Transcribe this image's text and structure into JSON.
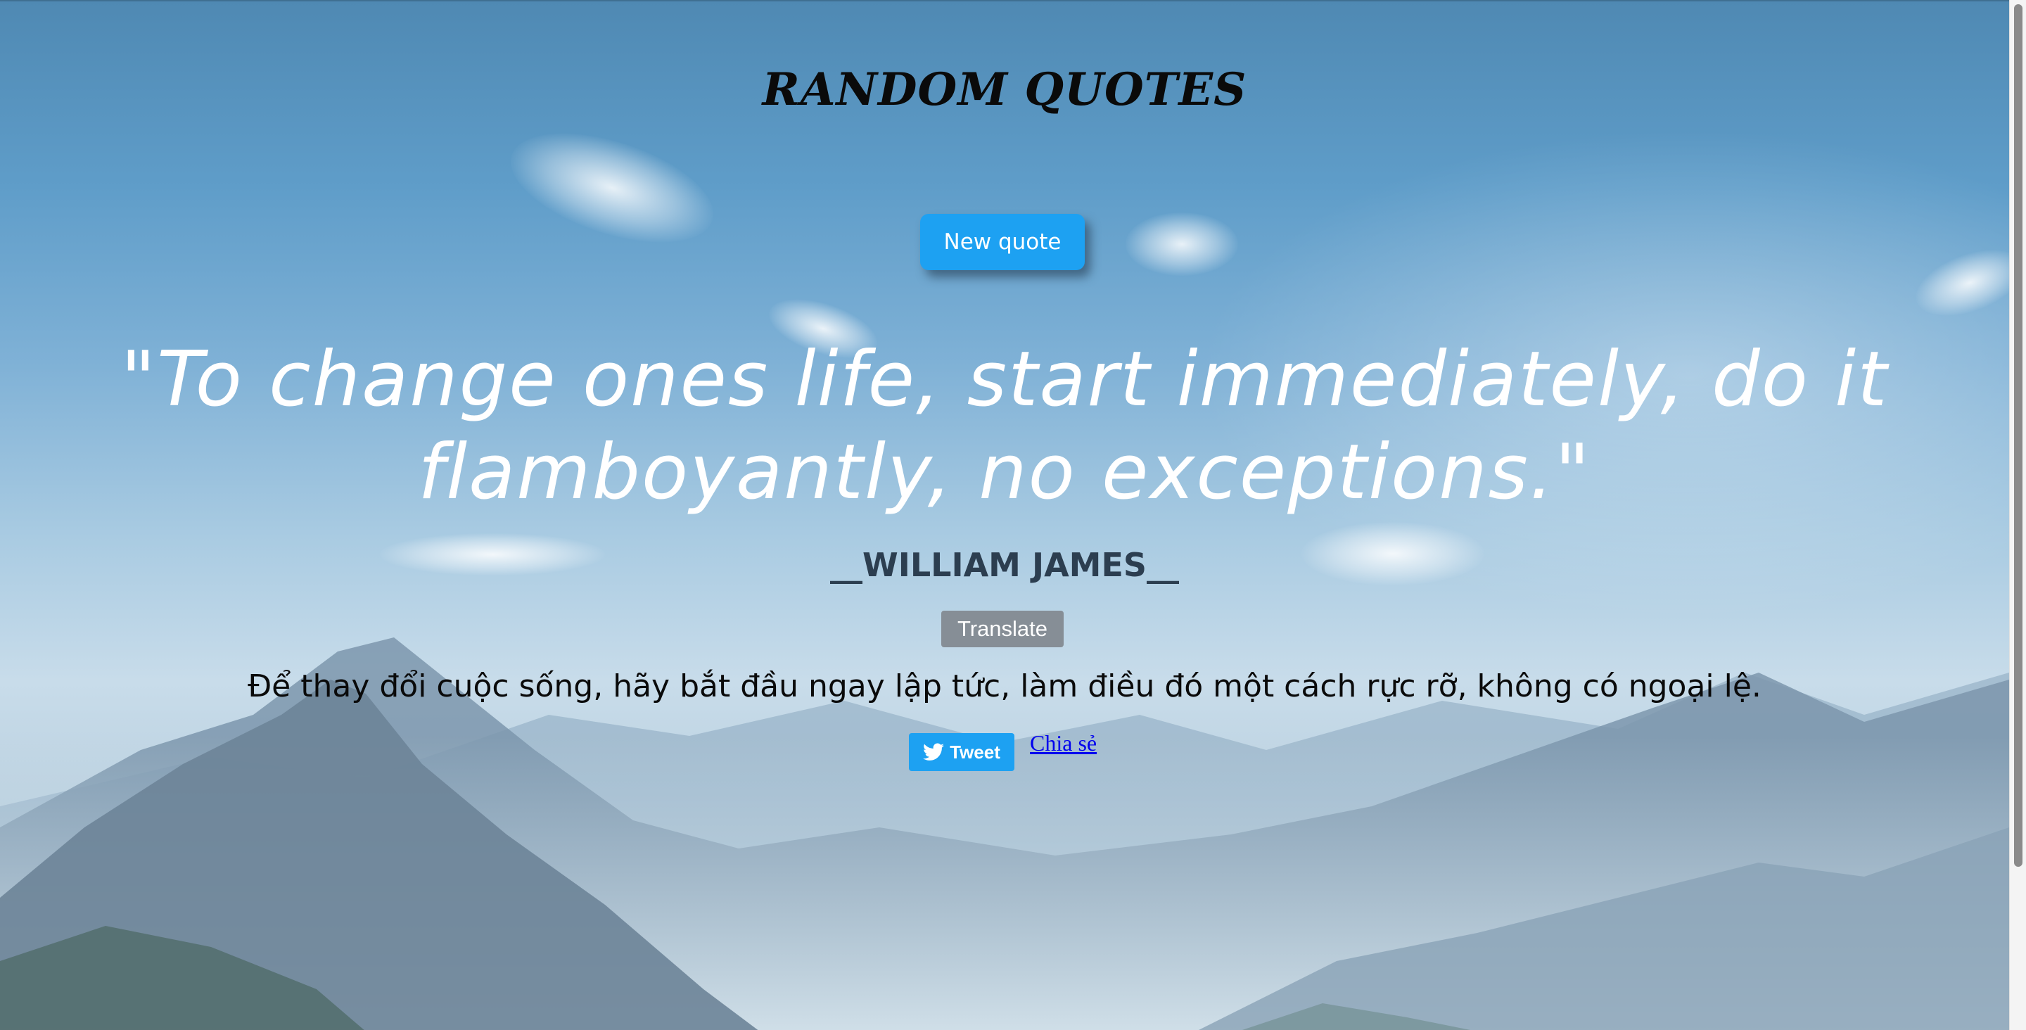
{
  "header": {
    "title": "RANDOM QUOTES"
  },
  "controls": {
    "new_quote_label": "New quote",
    "translate_label": "Translate"
  },
  "quote": {
    "text": "\"To change ones life, start immediately, do it flamboyantly, no exceptions.\"",
    "author": "__WILLIAM JAMES__",
    "translation": "Để thay đổi cuộc sống, hãy bắt đầu ngay lập tức, làm điều đó một cách rực rỡ, không có ngoại lệ."
  },
  "share": {
    "tweet_label": "Tweet",
    "share_link_label": "Chia sẻ",
    "tweet_icon": "twitter-bird-icon"
  },
  "colors": {
    "accent": "#1da1f2",
    "translate_button": "#868e96",
    "author_text": "#2c3e50",
    "link": "#0000ee"
  }
}
